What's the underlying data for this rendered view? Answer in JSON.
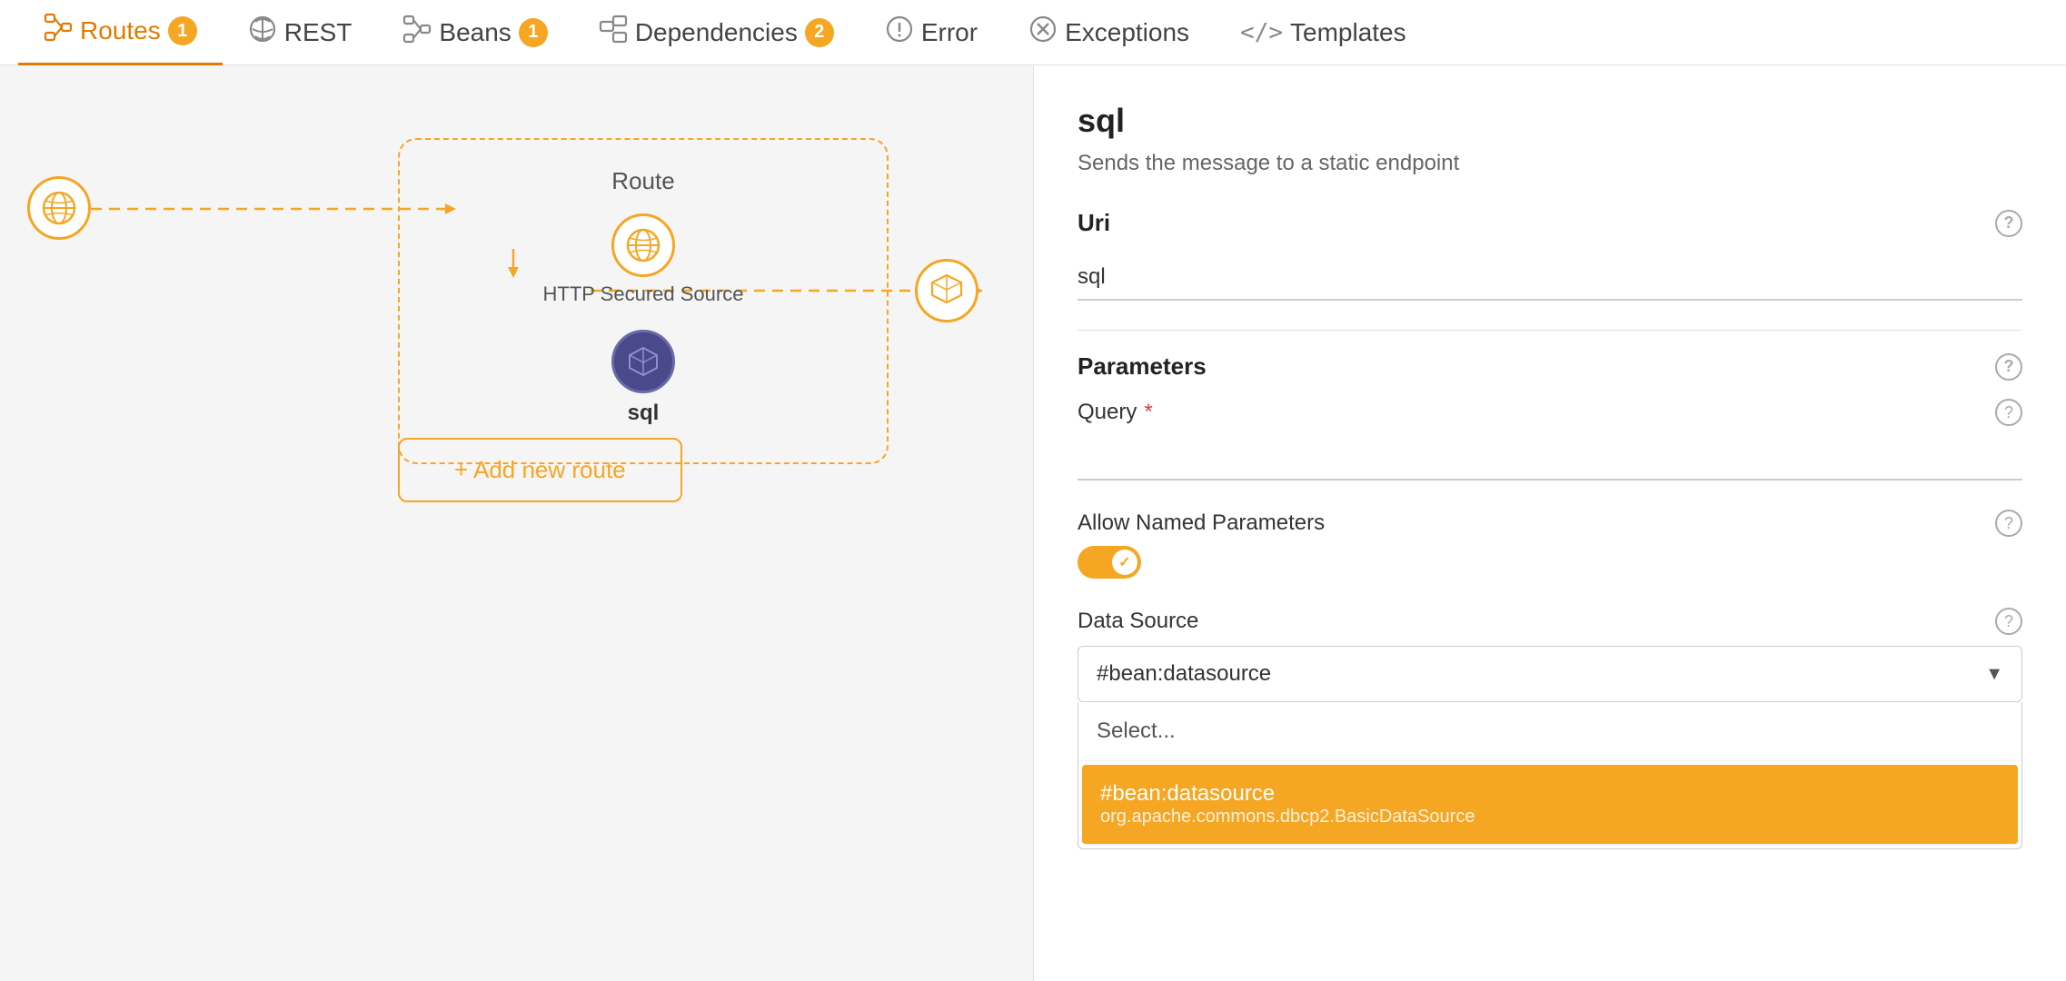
{
  "nav": {
    "tabs": [
      {
        "id": "routes",
        "label": "Routes",
        "badge": "1",
        "icon": "⊞",
        "active": true
      },
      {
        "id": "rest",
        "label": "REST",
        "badge": null,
        "icon": "☁",
        "active": false
      },
      {
        "id": "beans",
        "label": "Beans",
        "badge": "1",
        "icon": "⊞",
        "active": false
      },
      {
        "id": "dependencies",
        "label": "Dependencies",
        "badge": "2",
        "icon": "⊟",
        "active": false
      },
      {
        "id": "error",
        "label": "Error",
        "badge": null,
        "icon": "⚠",
        "active": false
      },
      {
        "id": "exceptions",
        "label": "Exceptions",
        "badge": null,
        "icon": "⊗",
        "active": false
      },
      {
        "id": "templates",
        "label": "Templates",
        "badge": null,
        "icon": "</>",
        "active": false
      }
    ]
  },
  "canvas": {
    "route_label": "Route",
    "http_source_label": "HTTP Secured Source",
    "sql_label": "sql",
    "add_route_label": "+ Add new route"
  },
  "panel": {
    "title": "sql",
    "subtitle": "Sends the message to a static endpoint",
    "uri_label": "Uri",
    "uri_value": "sql",
    "parameters_label": "Parameters",
    "query_label": "Query",
    "query_required": "*",
    "allow_named_params_label": "Allow Named Parameters",
    "toggle_on": true,
    "data_source_label": "Data Source",
    "data_source_value": "#bean:datasource",
    "dropdown_placeholder": "Select...",
    "dropdown_options": [
      {
        "value": "#bean:datasource",
        "sub": "org.apache.commons.dbcp2.BasicDataSource",
        "selected": true
      }
    ]
  },
  "colors": {
    "orange": "#f5a623",
    "active_tab": "#e07b00",
    "dark_node": "#4a4a8a",
    "selected_bg": "#f5a623"
  }
}
